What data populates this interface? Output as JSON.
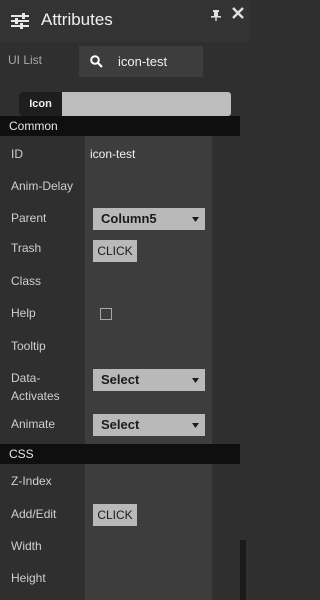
{
  "window": {
    "title": "Attributes",
    "icons": [
      "sliders-icon",
      "pin-icon",
      "close-icon"
    ]
  },
  "search": {
    "label": "UI List",
    "value": "icon-test",
    "icon": "search-icon"
  },
  "tabs": [
    {
      "label": "Icon",
      "active": true
    }
  ],
  "sections": {
    "common": {
      "title": "Common",
      "fields": {
        "id": {
          "label": "ID",
          "value": "icon-test"
        },
        "anim_delay": {
          "label": "Anim-Delay",
          "value": ""
        },
        "parent": {
          "label": "Parent",
          "value": "Column5"
        },
        "trash": {
          "label": "Trash",
          "button": "CLICK"
        },
        "class": {
          "label": "Class",
          "value": ""
        },
        "help": {
          "label": "Help",
          "checked": false
        },
        "tooltip": {
          "label": "Tooltip",
          "value": ""
        },
        "data_activates": {
          "label_line1": "Data-",
          "label_line2": "Activates",
          "value": "Select"
        },
        "animate": {
          "label": "Animate",
          "value": "Select"
        }
      }
    },
    "css": {
      "title": "CSS",
      "fields": {
        "z_index": {
          "label": "Z-Index",
          "value": ""
        },
        "add_edit": {
          "label": "Add/Edit",
          "button": "CLICK"
        },
        "width": {
          "label": "Width",
          "value": ""
        },
        "height": {
          "label": "Height",
          "value": ""
        }
      }
    }
  },
  "colors": {
    "background": "#2f2f2f",
    "cell": "#3d3d3d",
    "section_header": "#0f0f0f",
    "control": "#b9b9b9"
  }
}
